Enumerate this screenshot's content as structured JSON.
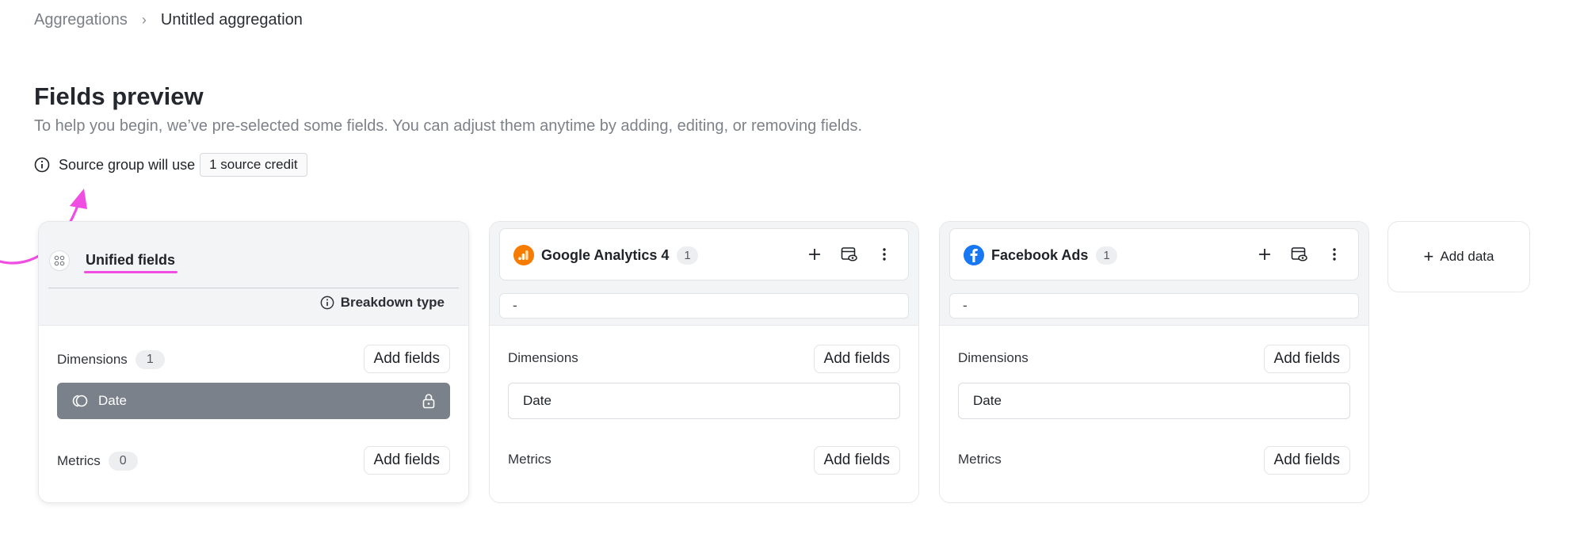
{
  "breadcrumb": {
    "parent": "Aggregations",
    "separator": "›",
    "current": "Untitled aggregation"
  },
  "header": {
    "title": "Fields preview",
    "subtitle": "To help you begin, we’ve pre-selected some fields. You can adjust them anytime by adding, editing, or removing fields."
  },
  "credit": {
    "text": "Source group will use",
    "badge": "1 source credit"
  },
  "colors": {
    "annotation": "#f04ee3",
    "locked_row": "#7b818a",
    "ga_orange": "#f57c00",
    "fb_blue": "#1877f2"
  },
  "unified": {
    "title": "Unified fields",
    "icon": "grid-icon",
    "breakdown_label": "Breakdown type",
    "dimensions_label": "Dimensions",
    "dimensions_count": "1",
    "metrics_label": "Metrics",
    "metrics_count": "0",
    "add_label": "Add fields",
    "dimension_row": "Date"
  },
  "sources": [
    {
      "name": "Google Analytics 4",
      "count": "1",
      "icon": "google-analytics-icon",
      "field_value": "-",
      "dimensions_label": "Dimensions",
      "metrics_label": "Metrics",
      "add_label": "Add fields",
      "dimension_row": "Date"
    },
    {
      "name": "Facebook Ads",
      "count": "1",
      "icon": "facebook-icon",
      "field_value": "-",
      "dimensions_label": "Dimensions",
      "metrics_label": "Metrics",
      "add_label": "Add fields",
      "dimension_row": "Date"
    }
  ],
  "add_data": {
    "label": "Add data",
    "icon": "plus-icon"
  }
}
